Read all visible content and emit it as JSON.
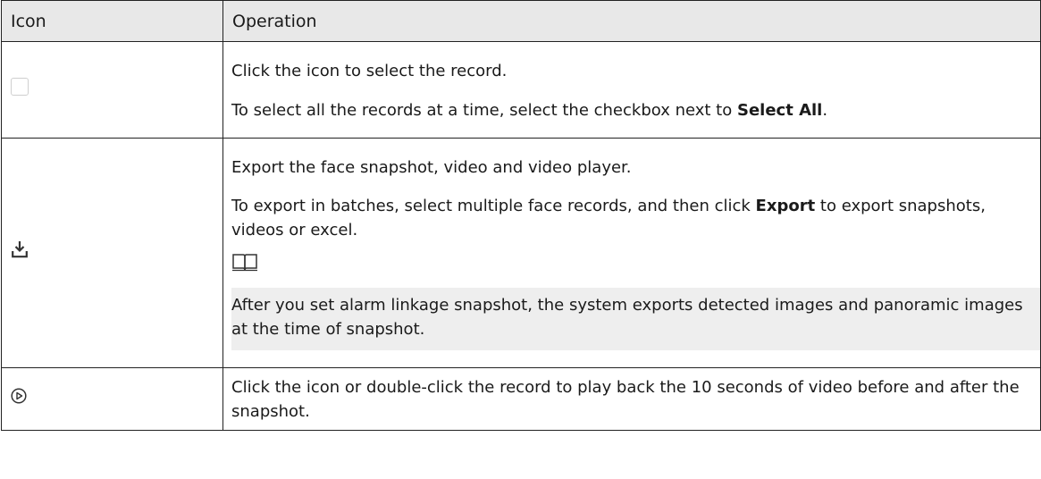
{
  "table": {
    "headers": {
      "icon": "Icon",
      "operation": "Operation"
    },
    "rows": [
      {
        "icon": "checkbox-icon",
        "line1": "Click the icon to select the record.",
        "line2_pre": "To select all the records at a time, select the checkbox next to ",
        "line2_bold": "Select All",
        "line2_post": "."
      },
      {
        "icon": "download-icon",
        "line1": "Export the face snapshot, video and video player.",
        "line2_pre": "To export in batches, select multiple face records, and then click ",
        "line2_bold": "Export",
        "line2_post": "  to export snapshots, videos or excel.",
        "note_icon": "book-icon",
        "note_text": "After you set alarm linkage snapshot, the system exports detected images and panoramic images at the time of snapshot."
      },
      {
        "icon": "play-circle-icon",
        "line1": "Click the icon or double-click the record to play back the 10 seconds of video before and after the snapshot."
      }
    ]
  }
}
